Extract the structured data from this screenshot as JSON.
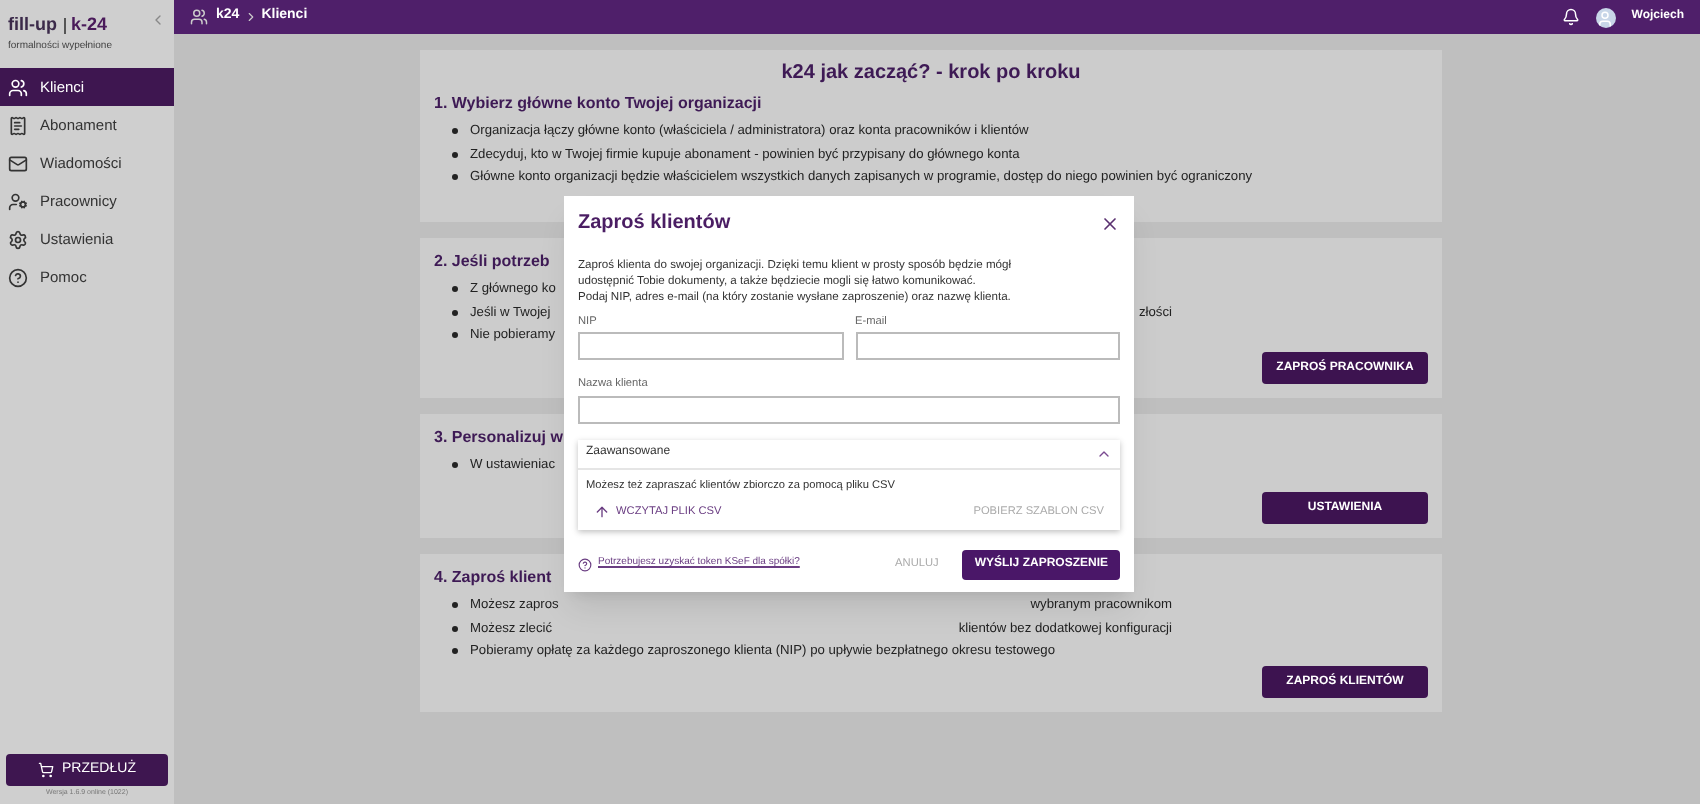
{
  "brand": {
    "logo_left": "fill-up",
    "logo_right": "k-24",
    "tagline": "formalności wypełnione"
  },
  "sidebar": {
    "items": [
      {
        "label": "Klienci",
        "selected": true
      },
      {
        "label": "Abonament",
        "selected": false
      },
      {
        "label": "Wiadomości",
        "selected": false
      },
      {
        "label": "Pracownicy",
        "selected": false
      },
      {
        "label": "Ustawienia",
        "selected": false
      },
      {
        "label": "Pomoc",
        "selected": false
      }
    ],
    "extend_button": "PRZEDŁUŻ",
    "version": "Wersja 1.6.9 online (1022)"
  },
  "breadcrumb": [
    "k24",
    "Klienci"
  ],
  "user": "Wojciech",
  "page_title": "k24 jak zacząć? - krok po kroku",
  "sections": [
    {
      "title": "1. Wybierz główne konto Twojej organizacji",
      "bullets": [
        {
          "text": "Organizacja łączy główne konto (właściciela / administratora) oraz konta pracowników i klientów"
        },
        {
          "text": "Zdecyduj, kto w Twojej firmie kupuje abonament - powinien być przypisany do głównego konta"
        },
        {
          "text": "Główne konto organizacji będzie właścicielem wszystkich danych zapisanych w programie, dostęp do niego powinien być ograniczony"
        }
      ]
    },
    {
      "title": "2. Jeśli potrzeb",
      "bullets": [
        {
          "text": "Z głównego ko"
        },
        {
          "text": "Jeśli w Twojej",
          "text_right": "złości"
        },
        {
          "text": "Nie pobieramy"
        }
      ],
      "button": "ZAPROŚ PRACOWNIKA"
    },
    {
      "title": "3. Personalizuj w",
      "bullets": [
        {
          "text": "W ustawieniac"
        }
      ],
      "button": "USTAWIENIA"
    },
    {
      "title": "4. Zaproś klient",
      "bullets": [
        {
          "text": "Możesz zapros",
          "text_right": "wybranym pracownikom"
        },
        {
          "text": "Możesz zlecić",
          "text_right": "klientów bez dodatkowej konfiguracji"
        },
        {
          "text": "Pobieramy opłatę za każdego zaproszonego klienta (NIP) po upływie bezpłatnego okresu testowego"
        }
      ],
      "button": "ZAPROŚ KLIENTÓW"
    }
  ],
  "dialog": {
    "title": "Zaproś klientów",
    "intro": "Zaproś klienta do swojej organizacji. Dzięki temu klient w prosty sposób będzie mógł udostępnić Tobie dokumenty, a także będziecie mogli się łatwo komunikować.",
    "instruction": "Podaj NIP, adres e-mail (na który zostanie wysłane zaproszenie) oraz nazwę klienta.",
    "fields": [
      {
        "label": "NIP"
      },
      {
        "label": "E-mail"
      },
      {
        "label": "Nazwa klienta"
      }
    ],
    "advanced": {
      "label": "Zaawansowane",
      "expanded": true,
      "text": "Możesz też zapraszać klientów zbiorczo za pomocą pliku CSV",
      "upload": "WCZYTAJ PLIK CSV",
      "download": "POBIERZ SZABLON CSV"
    },
    "help_link": "Potrzebujesz uzyskać token KSeF dla spółki?",
    "cancel": "ANULUJ",
    "submit": "WYŚLIJ ZAPROSZENIE"
  }
}
